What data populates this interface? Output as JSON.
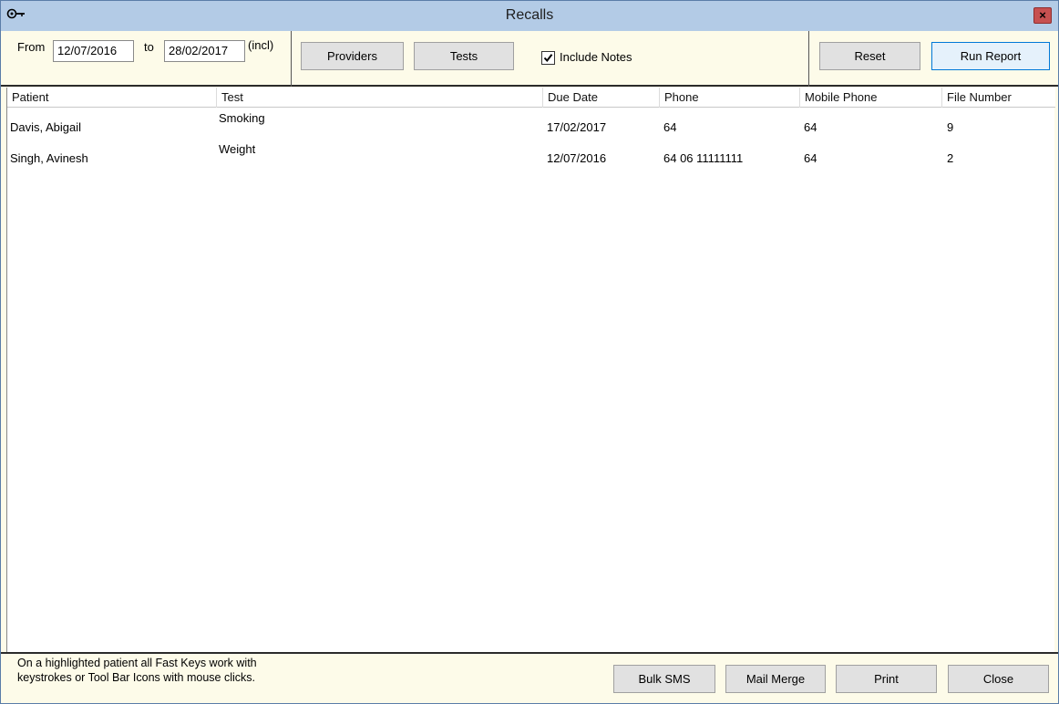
{
  "window": {
    "title": "Recalls",
    "close_label": "×"
  },
  "filters": {
    "from_label": "From",
    "from_value": "12/07/2016",
    "to_label": "to",
    "to_value": "28/02/2017",
    "incl_label": "(incl)"
  },
  "toolbar": {
    "providers_label": "Providers",
    "tests_label": "Tests",
    "include_notes_label": "Include Notes",
    "include_notes_checked": true,
    "reset_label": "Reset",
    "run_report_label": "Run Report"
  },
  "table": {
    "columns": [
      "Patient",
      "Test",
      "Due Date",
      "Phone",
      "Mobile Phone",
      "File Number"
    ],
    "rows": [
      {
        "patient": "Davis, Abigail",
        "test": "Smoking",
        "due_date": "17/02/2017",
        "phone": "64",
        "mobile": "64",
        "file_number": "9"
      },
      {
        "patient": "Singh, Avinesh",
        "test": "Weight",
        "due_date": "12/07/2016",
        "phone": "64 06 11111111",
        "mobile": "64",
        "file_number": "2"
      }
    ]
  },
  "footer": {
    "note_line1": "On a highlighted patient all Fast Keys work with",
    "note_line2": "keystrokes or Tool Bar Icons with mouse clicks.",
    "bulk_sms_label": "Bulk SMS",
    "mail_merge_label": "Mail Merge",
    "print_label": "Print",
    "close_label": "Close"
  },
  "icons": {
    "app": "key-icon",
    "close": "close-icon",
    "check": "checkmark-icon"
  },
  "colors": {
    "titlebar": "#b3cbe6",
    "panel": "#fdfbe9",
    "close_button": "#c75050",
    "primary_border": "#0078d7"
  }
}
